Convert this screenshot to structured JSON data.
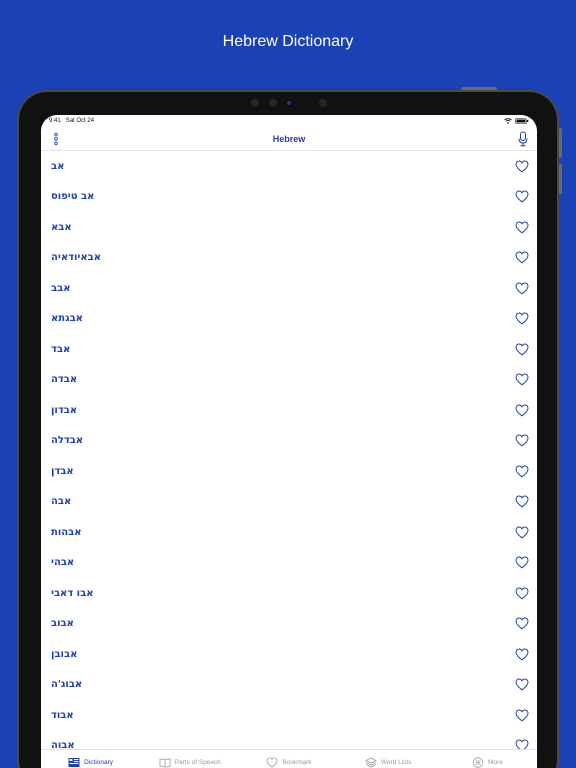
{
  "promo": {
    "title": "Hebrew Dictionary"
  },
  "status": {
    "time": "9:41",
    "date": "Sat Oct 24",
    "battery": "100%"
  },
  "nav": {
    "title": "Hebrew"
  },
  "words": [
    "אב",
    "אב טיפוס",
    "אבא",
    "אבאיודאיה",
    "אבב",
    "אבגתא",
    "אבד",
    "אבדה",
    "אבדון",
    "אבדלה",
    "אבדן",
    "אבה",
    "אבהות",
    "אבהי",
    "אבו דאבי",
    "אבוב",
    "אבובן",
    "אבוג'ה",
    "אבוד",
    "אבוה"
  ],
  "tabs": [
    {
      "label": "Dictionary",
      "icon": "dictionary-icon",
      "active": true
    },
    {
      "label": "Parts of Speech",
      "icon": "book-icon",
      "active": false
    },
    {
      "label": "Bookmark",
      "icon": "heart-icon",
      "active": false
    },
    {
      "label": "Word Lists",
      "icon": "stack-icon",
      "active": false
    },
    {
      "label": "More",
      "icon": "more-icon",
      "active": false
    }
  ],
  "colors": {
    "background": "#1a42b5",
    "accent": "#1e3fae",
    "inactive": "#9a9a9a"
  }
}
